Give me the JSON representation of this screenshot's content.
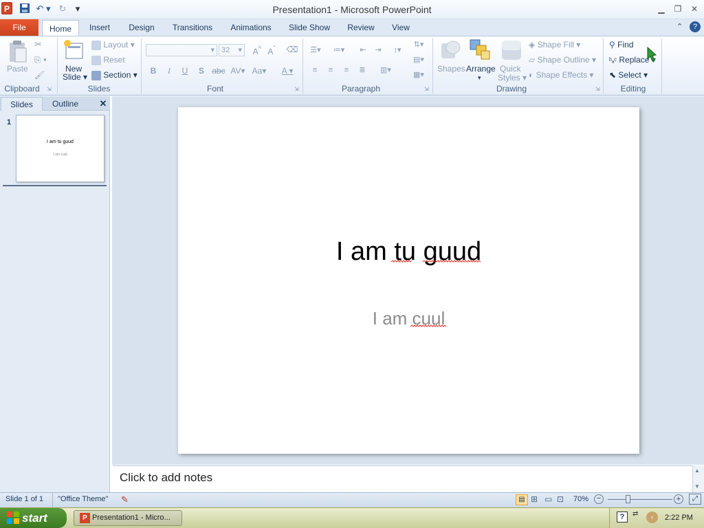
{
  "window": {
    "title": "Presentation1 - Microsoft PowerPoint",
    "app_icon_letter": "P"
  },
  "tabs": {
    "file": "File",
    "items": [
      "Home",
      "Insert",
      "Design",
      "Transitions",
      "Animations",
      "Slide Show",
      "Review",
      "View"
    ]
  },
  "ribbon": {
    "clipboard": {
      "label": "Clipboard",
      "paste": "Paste"
    },
    "slides": {
      "label": "Slides",
      "new_slide_1": "New",
      "new_slide_2": "Slide",
      "layout": "Layout",
      "reset": "Reset",
      "section": "Section"
    },
    "font": {
      "label": "Font",
      "font_size": "32"
    },
    "paragraph": {
      "label": "Paragraph"
    },
    "drawing": {
      "label": "Drawing",
      "shapes": "Shapes",
      "arrange": "Arrange",
      "quick_styles_1": "Quick",
      "quick_styles_2": "Styles",
      "shape_fill": "Shape Fill",
      "shape_outline": "Shape Outline",
      "shape_effects": "Shape Effects"
    },
    "editing": {
      "label": "Editing",
      "find": "Find",
      "replace": "Replace",
      "select": "Select"
    }
  },
  "left_panel": {
    "tab_slides": "Slides",
    "tab_outline": "Outline",
    "slide_number": "1",
    "thumb_title": "I am tu guud",
    "thumb_sub": "I am cuul"
  },
  "slide": {
    "title": "I am tu guud",
    "subtitle": "I am cuul"
  },
  "notes": {
    "placeholder": "Click to add notes"
  },
  "status": {
    "slide_info": "Slide 1 of 1",
    "theme": "\"Office Theme\"",
    "zoom": "70%",
    "zoom_level_percent": 70
  },
  "taskbar": {
    "start": "start",
    "task": "Presentation1 - Micro...",
    "clock": "2:22 PM"
  },
  "colors": {
    "file_tab": "#d24726",
    "ribbon_bg": "#e6eef8",
    "taskbar": "#c9cf9b",
    "start": "#3c7a22"
  }
}
